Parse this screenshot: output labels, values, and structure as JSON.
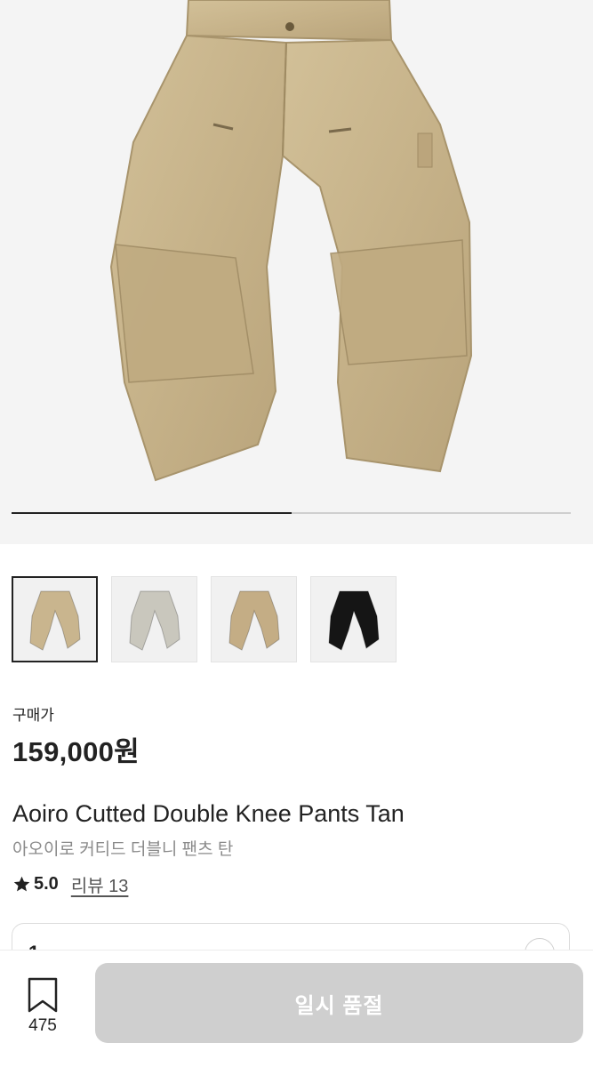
{
  "gallery": {
    "progress": 0.5,
    "thumbnails": [
      {
        "name": "tan",
        "color": "#c9b58e",
        "active": true
      },
      {
        "name": "light-gray",
        "color": "#c9c7bd",
        "active": false
      },
      {
        "name": "tan-alt",
        "color": "#c4ad85",
        "active": false
      },
      {
        "name": "black",
        "color": "#151515",
        "active": false
      }
    ]
  },
  "price": {
    "label": "구매가",
    "value": "159,000원"
  },
  "product": {
    "title_en": "Aoiro Cutted Double Knee Pants Tan",
    "title_ko": "아오이로 커티드 더블니 팬츠 탄",
    "rating": "5.0",
    "review_label": "리뷰 13"
  },
  "option": {
    "peek_text": "1"
  },
  "bottom": {
    "bookmark_count": "475",
    "button_label": "일시 품절"
  },
  "colors": {
    "accent": "#222222",
    "button_disabled": "#cfcfcf",
    "subtext": "#8a8a8a"
  }
}
